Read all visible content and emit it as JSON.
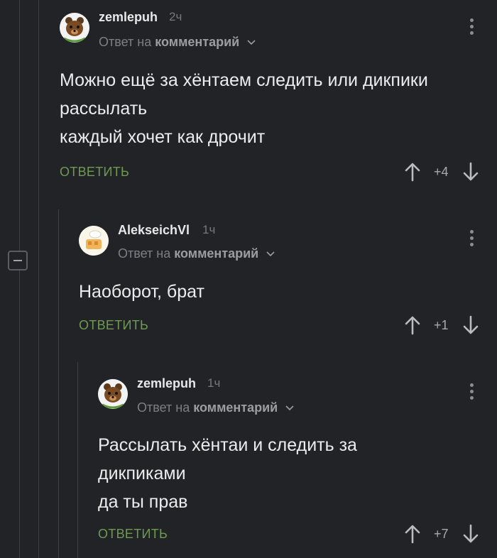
{
  "comments": [
    {
      "username": "zemlepuh",
      "time": "2ч",
      "reply_prefix": "Ответ на",
      "reply_target": "комментарий",
      "body_lines": [
        "Можно ещё за хёнтаем следить или дикпики",
        "рассылать",
        "каждый хочет как дрочит"
      ],
      "reply_label": "ОТВЕТИТЬ",
      "score": "+4",
      "avatar": "bear-avatar-icon"
    },
    {
      "username": "AlekseichVl",
      "time": "1ч",
      "reply_prefix": "Ответ на",
      "reply_target": "комментарий",
      "body_lines": [
        "Наоборот, брат"
      ],
      "reply_label": "ОТВЕТИТЬ",
      "score": "+1",
      "avatar": "chef-avatar-icon"
    },
    {
      "username": "zemlepuh",
      "time": "1ч",
      "reply_prefix": "Ответ на",
      "reply_target": "комментарий",
      "body_lines": [
        "Рассылать хёнтаи и следить за",
        "дикпиками",
        "да ты прав"
      ],
      "reply_label": "ОТВЕТИТЬ",
      "score": "+7",
      "avatar": "bear-avatar-icon"
    }
  ],
  "colors": {
    "background": "#222326",
    "reply_green": "#6f9a52",
    "muted": "#7c7f85"
  }
}
